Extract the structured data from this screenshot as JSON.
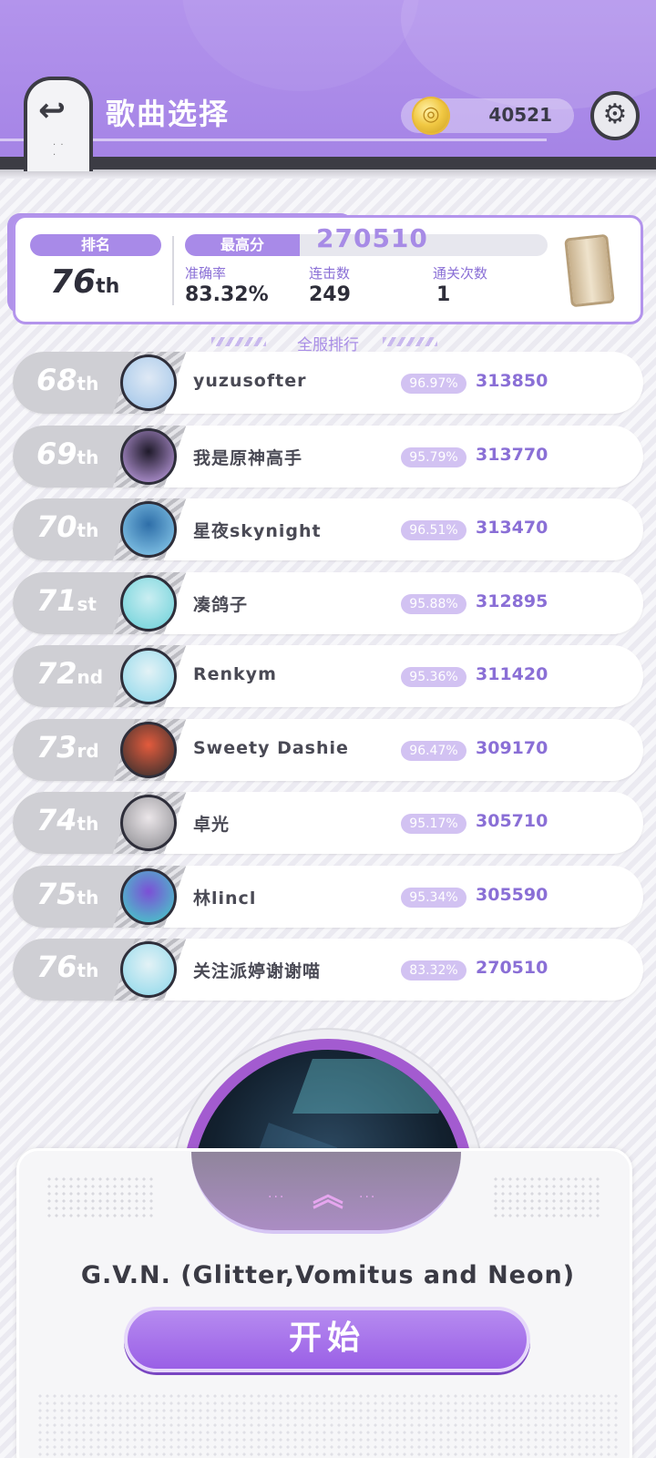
{
  "header": {
    "title": "歌曲选择",
    "coins": "40521",
    "back_icon": "back-arrow-icon",
    "settings_icon": "gear-icon"
  },
  "stats": {
    "rank_label": "排名",
    "rank_num": "76",
    "rank_suffix": "th",
    "highscore_label": "最高分",
    "highscore": "270510",
    "accuracy_label": "准确率",
    "accuracy": "83.32%",
    "combo_label": "连击数",
    "combo": "249",
    "clears_label": "通关次数",
    "clears": "1"
  },
  "leaderboard": {
    "title": "全服排行",
    "rows": [
      {
        "rank": "68",
        "suffix": "th",
        "name": "yuzusofter",
        "acc": "96.97%",
        "score": "313850"
      },
      {
        "rank": "69",
        "suffix": "th",
        "name": "我是原神高手",
        "acc": "95.79%",
        "score": "313770"
      },
      {
        "rank": "70",
        "suffix": "th",
        "name": "星夜skynight",
        "acc": "96.51%",
        "score": "313470"
      },
      {
        "rank": "71",
        "suffix": "st",
        "name": "凑鸽子",
        "acc": "95.88%",
        "score": "312895"
      },
      {
        "rank": "72",
        "suffix": "nd",
        "name": "Renkym",
        "acc": "95.36%",
        "score": "311420"
      },
      {
        "rank": "73",
        "suffix": "rd",
        "name": "Sweety Dashie",
        "acc": "96.47%",
        "score": "309170"
      },
      {
        "rank": "74",
        "suffix": "th",
        "name": "卓光",
        "acc": "95.17%",
        "score": "305710"
      },
      {
        "rank": "75",
        "suffix": "th",
        "name": "林lincl",
        "acc": "95.34%",
        "score": "305590"
      },
      {
        "rank": "76",
        "suffix": "th",
        "name": "关注派婷谢谢喵",
        "acc": "83.32%",
        "score": "270510"
      }
    ]
  },
  "song": {
    "title": "G.V.N. (Glitter,Vomitus and Neon)",
    "start_label": "开始"
  },
  "colors": {
    "accent": "#a88ae8",
    "header": "#b394ec",
    "start_button": "#9a5fe6"
  }
}
